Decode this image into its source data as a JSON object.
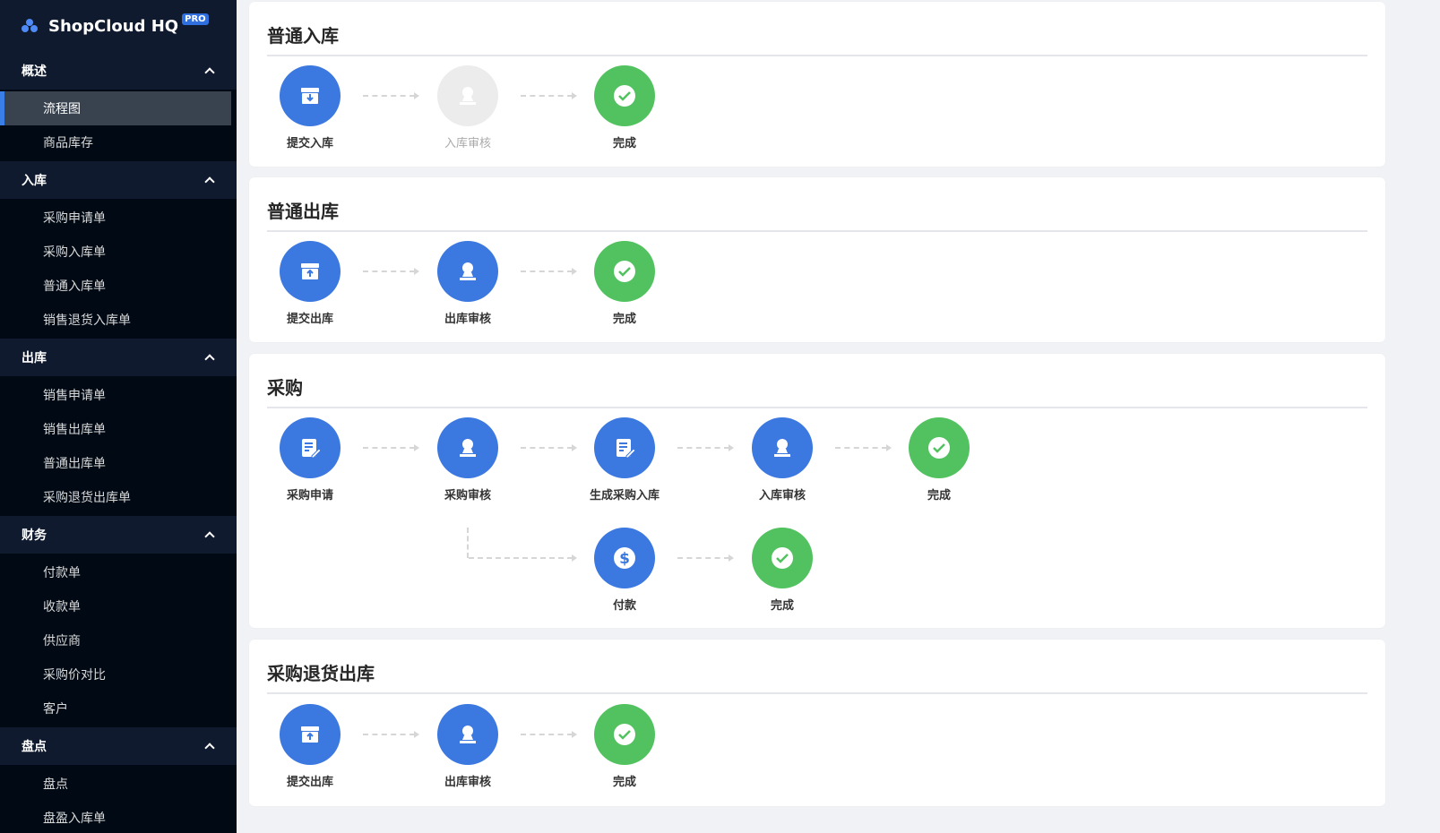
{
  "app": {
    "name": "ShopCloud HQ",
    "badge": "PRO"
  },
  "sidebar": {
    "groups": [
      {
        "title": "概述",
        "items": [
          "流程图",
          "商品库存"
        ]
      },
      {
        "title": "入库",
        "items": [
          "采购申请单",
          "采购入库单",
          "普通入库单",
          "销售退货入库单"
        ]
      },
      {
        "title": "出库",
        "items": [
          "销售申请单",
          "销售出库单",
          "普通出库单",
          "采购退货出库单"
        ]
      },
      {
        "title": "财务",
        "items": [
          "付款单",
          "收款单",
          "供应商",
          "采购价对比",
          "客户"
        ]
      },
      {
        "title": "盘点",
        "items": [
          "盘点",
          "盘盈入库单"
        ]
      }
    ],
    "active_item": "流程图"
  },
  "flows": [
    {
      "title": "普通入库",
      "steps": [
        {
          "label": "提交入库",
          "icon": "box-in-icon",
          "color": "#3b78e0"
        },
        {
          "label": "入库审核",
          "icon": "user-stamp-icon",
          "color": "#ececec",
          "disabled": true
        },
        {
          "label": "完成",
          "icon": "check-icon",
          "color": "#52c260"
        }
      ]
    },
    {
      "title": "普通出库",
      "steps": [
        {
          "label": "提交出库",
          "icon": "box-out-icon",
          "color": "#3b78e0"
        },
        {
          "label": "出库审核",
          "icon": "user-stamp-icon",
          "color": "#3b78e0"
        },
        {
          "label": "完成",
          "icon": "check-icon",
          "color": "#52c260"
        }
      ]
    },
    {
      "title": "采购",
      "steps": [
        {
          "label": "采购申请",
          "icon": "edit-doc-icon",
          "color": "#3b78e0"
        },
        {
          "label": "采购审核",
          "icon": "user-stamp-icon",
          "color": "#3b78e0"
        },
        {
          "label": "生成采购入库",
          "icon": "edit-doc-icon",
          "color": "#3b78e0"
        },
        {
          "label": "入库审核",
          "icon": "user-stamp-icon",
          "color": "#3b78e0"
        },
        {
          "label": "完成",
          "icon": "check-icon",
          "color": "#52c260"
        }
      ],
      "branch": [
        {
          "label": "付款",
          "icon": "dollar-icon",
          "color": "#3b78e0"
        },
        {
          "label": "完成",
          "icon": "check-icon",
          "color": "#52c260"
        }
      ]
    },
    {
      "title": "采购退货出库",
      "steps": [
        {
          "label": "提交出库",
          "icon": "box-out-icon",
          "color": "#3b78e0"
        },
        {
          "label": "出库审核",
          "icon": "user-stamp-icon",
          "color": "#3b78e0"
        },
        {
          "label": "完成",
          "icon": "check-icon",
          "color": "#52c260"
        }
      ]
    }
  ]
}
